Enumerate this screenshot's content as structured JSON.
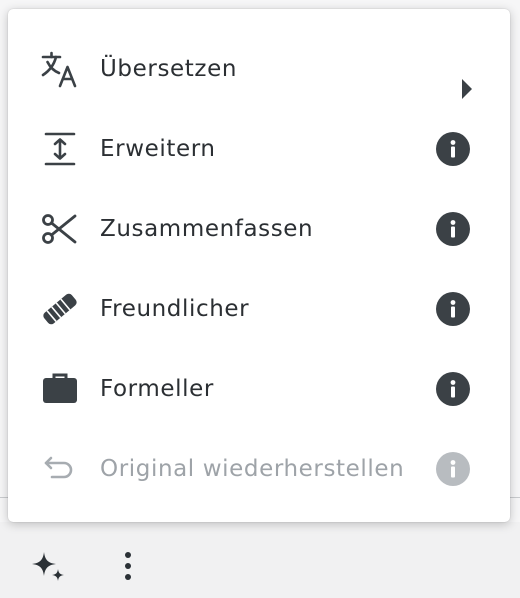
{
  "menu": {
    "items": [
      {
        "label": "Übersetzen",
        "icon": "translate-icon",
        "trailing": "submenu-arrow-icon"
      },
      {
        "label": "Erweitern",
        "icon": "expand-vertical-icon",
        "trailing": "info-icon"
      },
      {
        "label": "Zusammenfassen",
        "icon": "scissors-icon",
        "trailing": "info-icon"
      },
      {
        "label": "Freundlicher",
        "icon": "handshake-icon",
        "trailing": "info-icon"
      },
      {
        "label": "Formeller",
        "icon": "briefcase-icon",
        "trailing": "info-icon"
      },
      {
        "label": "Original wiederherstellen",
        "icon": "undo-icon",
        "trailing": "info-icon",
        "disabled": true
      }
    ]
  },
  "toolbar": {
    "buttons": [
      {
        "icon": "sparkles-icon"
      },
      {
        "icon": "more-vertical-icon"
      }
    ]
  },
  "colors": {
    "text": "#2b2f33",
    "icon": "#3b4146",
    "disabled": "#9ea3a8",
    "menu_background": "#ffffff"
  }
}
